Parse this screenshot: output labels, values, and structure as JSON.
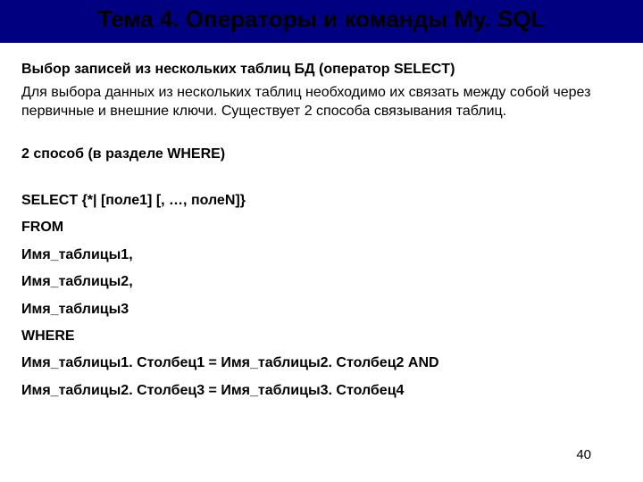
{
  "title": "Тема 4. Операторы и команды My. SQL",
  "subtitle": "Выбор записей из нескольких таблиц БД (оператор SELECT)",
  "bodyText": "Для выбора данных из нескольких таблиц необходимо их связать между собой через первичные и внешние ключи. Существует 2 способа связывания таблиц.",
  "methodTitle": "2 способ (в разделе WHERE)",
  "codeLines": [
    "SELECT {*| [поле1] [, …, полеN]}",
    "FROM",
    "Имя_таблицы1,",
    "Имя_таблицы2,",
    "Имя_таблицы3",
    "WHERE",
    "Имя_таблицы1. Столбец1 = Имя_таблицы2. Столбец2 AND",
    "Имя_таблицы2. Столбец3 = Имя_таблицы3. Столбец4"
  ],
  "pageNumber": "40"
}
